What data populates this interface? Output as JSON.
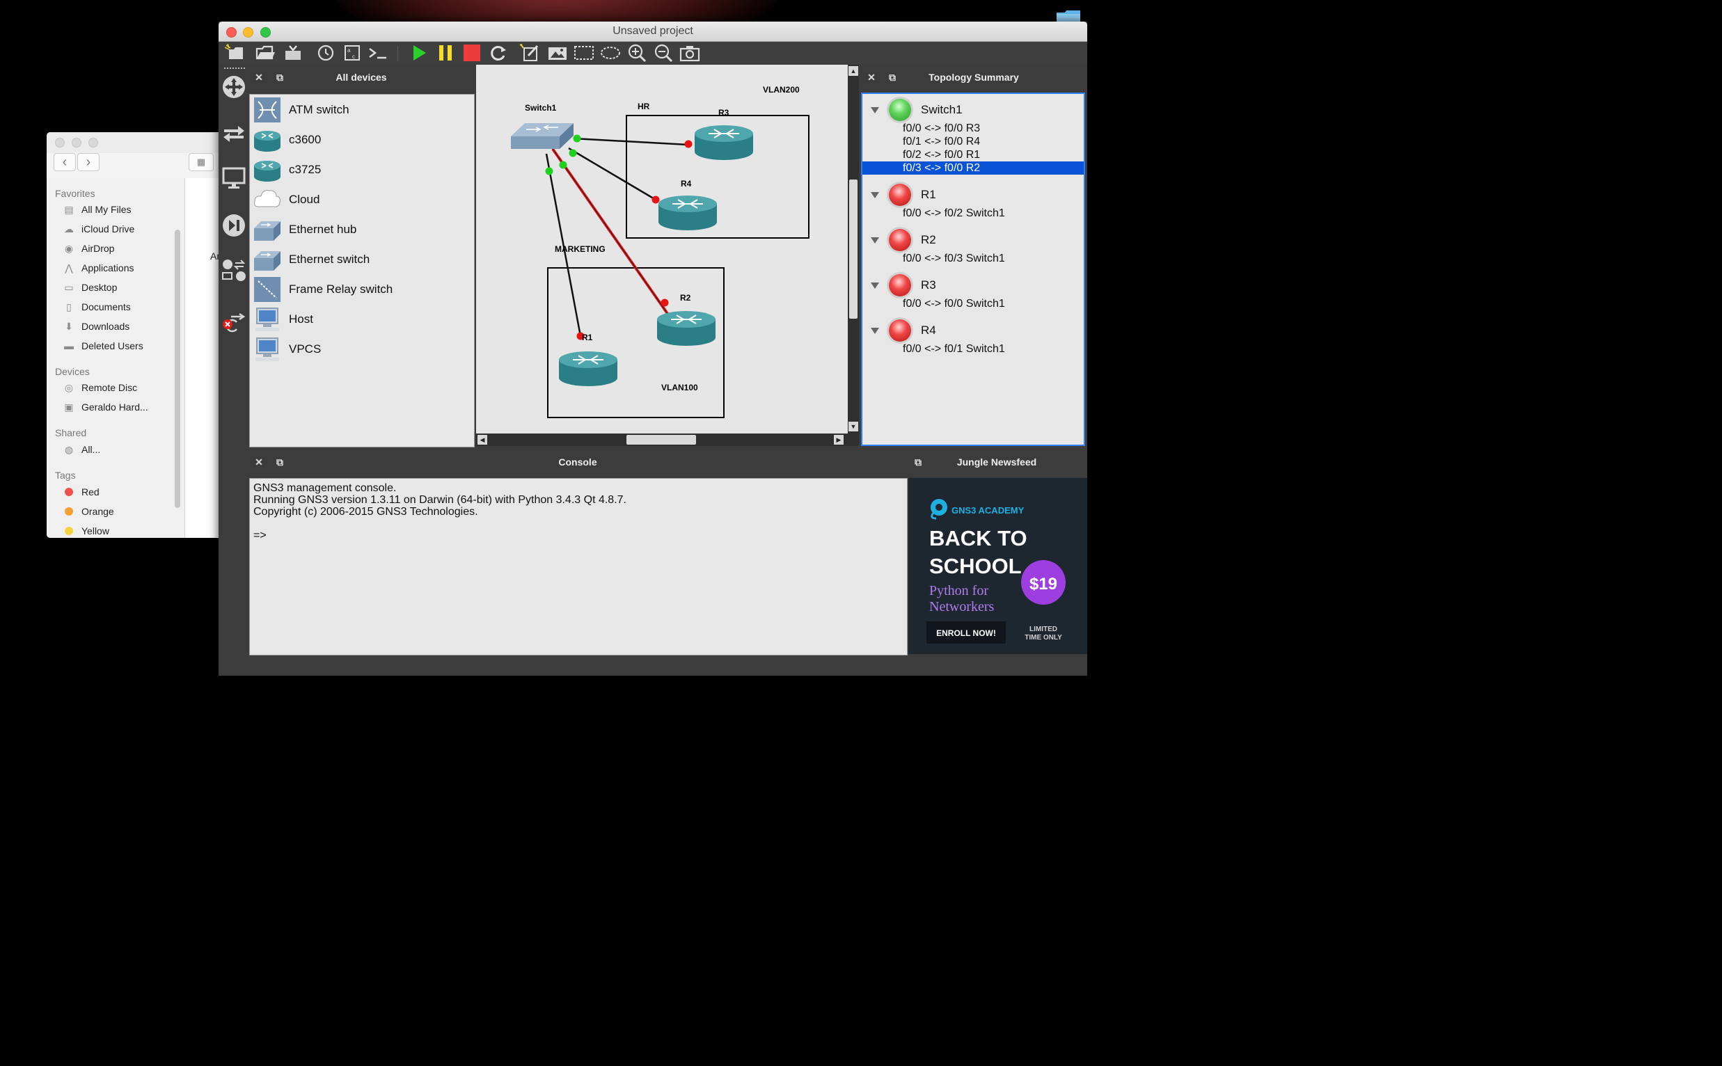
{
  "finder": {
    "sections": {
      "favorites": "Favorites",
      "devices": "Devices",
      "shared": "Shared",
      "tags": "Tags"
    },
    "favorites": [
      {
        "label": "All My Files",
        "icon": "all-my-files-icon"
      },
      {
        "label": "iCloud Drive",
        "icon": "cloud-icon"
      },
      {
        "label": "AirDrop",
        "icon": "airdrop-icon"
      },
      {
        "label": "Applications",
        "icon": "applications-icon"
      },
      {
        "label": "Desktop",
        "icon": "desktop-icon"
      },
      {
        "label": "Documents",
        "icon": "documents-icon"
      },
      {
        "label": "Downloads",
        "icon": "downloads-icon"
      },
      {
        "label": "Deleted Users",
        "icon": "folder-icon"
      }
    ],
    "devices": [
      {
        "label": "Remote Disc",
        "icon": "disc-icon"
      },
      {
        "label": "Geraldo Hard...",
        "icon": "hard-drive-icon"
      }
    ],
    "shared": [
      {
        "label": "All...",
        "icon": "network-icon"
      }
    ],
    "tags": [
      {
        "label": "Red",
        "color": "#f0514c"
      },
      {
        "label": "Orange",
        "color": "#f6a034"
      },
      {
        "label": "Yellow",
        "color": "#f5d33f"
      }
    ],
    "main_partial_text": "Ar"
  },
  "window": {
    "title": "Unsaved project"
  },
  "toolbar": {
    "buttons": [
      "new-project",
      "open-project",
      "save-project",
      "snapshot",
      "console-connect",
      "terminal",
      "start-all",
      "suspend-all",
      "stop-all",
      "reload-all",
      "add-note",
      "insert-image",
      "draw-rectangle",
      "draw-ellipse",
      "zoom-in",
      "zoom-out",
      "screenshot"
    ]
  },
  "devices_panel": {
    "title": "All devices",
    "items": [
      {
        "label": "ATM switch",
        "icon": "atm-switch-icon"
      },
      {
        "label": "c3600",
        "icon": "router-icon"
      },
      {
        "label": "c3725",
        "icon": "router-icon"
      },
      {
        "label": "Cloud",
        "icon": "cloud-icon"
      },
      {
        "label": "Ethernet hub",
        "icon": "ethernet-hub-icon"
      },
      {
        "label": "Ethernet switch",
        "icon": "ethernet-switch-icon"
      },
      {
        "label": "Frame Relay switch",
        "icon": "frame-relay-switch-icon"
      },
      {
        "label": "Host",
        "icon": "host-icon"
      },
      {
        "label": "VPCS",
        "icon": "vpcs-icon"
      }
    ]
  },
  "topology_canvas": {
    "labels": {
      "vlan200": "VLAN200",
      "hr": "HR",
      "marketing": "MARKETING",
      "vlan100": "VLAN100"
    },
    "nodes": {
      "switch1": "Switch1",
      "r1": "R1",
      "r2": "R2",
      "r3": "R3",
      "r4": "R4"
    },
    "link_colors": {
      "normal": "#111111",
      "selected": "#e8161b",
      "up": "#1fd11f",
      "down": "#e81313"
    }
  },
  "topology_summary": {
    "title": "Topology Summary",
    "nodes": [
      {
        "name": "Switch1",
        "status": "green",
        "links": [
          "f0/0 <-> f0/0 R3",
          "f0/1 <-> f0/0 R4",
          "f0/2 <-> f0/0 R1",
          "f0/3 <-> f0/0 R2"
        ],
        "selected_link": 3
      },
      {
        "name": "R1",
        "status": "red",
        "links": [
          "f0/0 <-> f0/2 Switch1"
        ]
      },
      {
        "name": "R2",
        "status": "red",
        "links": [
          "f0/0 <-> f0/3 Switch1"
        ]
      },
      {
        "name": "R3",
        "status": "red",
        "links": [
          "f0/0 <-> f0/0 Switch1"
        ]
      },
      {
        "name": "R4",
        "status": "red",
        "links": [
          "f0/0 <-> f0/1 Switch1"
        ]
      }
    ]
  },
  "console": {
    "title": "Console",
    "lines": [
      "GNS3 management console.",
      "Running GNS3 version 1.3.11 on Darwin (64-bit) with Python 3.4.3 Qt 4.8.7.",
      "Copyright (c) 2006-2015 GNS3 Technologies.",
      "",
      "=>"
    ]
  },
  "newsfeed": {
    "title": "Jungle Newsfeed",
    "ad": {
      "brand": "GNS3 ACADEMY",
      "headline_1": "BACK TO",
      "headline_2": "SCHOOL",
      "subtitle_1": "Python for",
      "subtitle_2": "Networkers",
      "price": "$19",
      "cta": "ENROLL NOW!",
      "limited_1": "LIMITED",
      "limited_2": "TIME ONLY"
    }
  }
}
